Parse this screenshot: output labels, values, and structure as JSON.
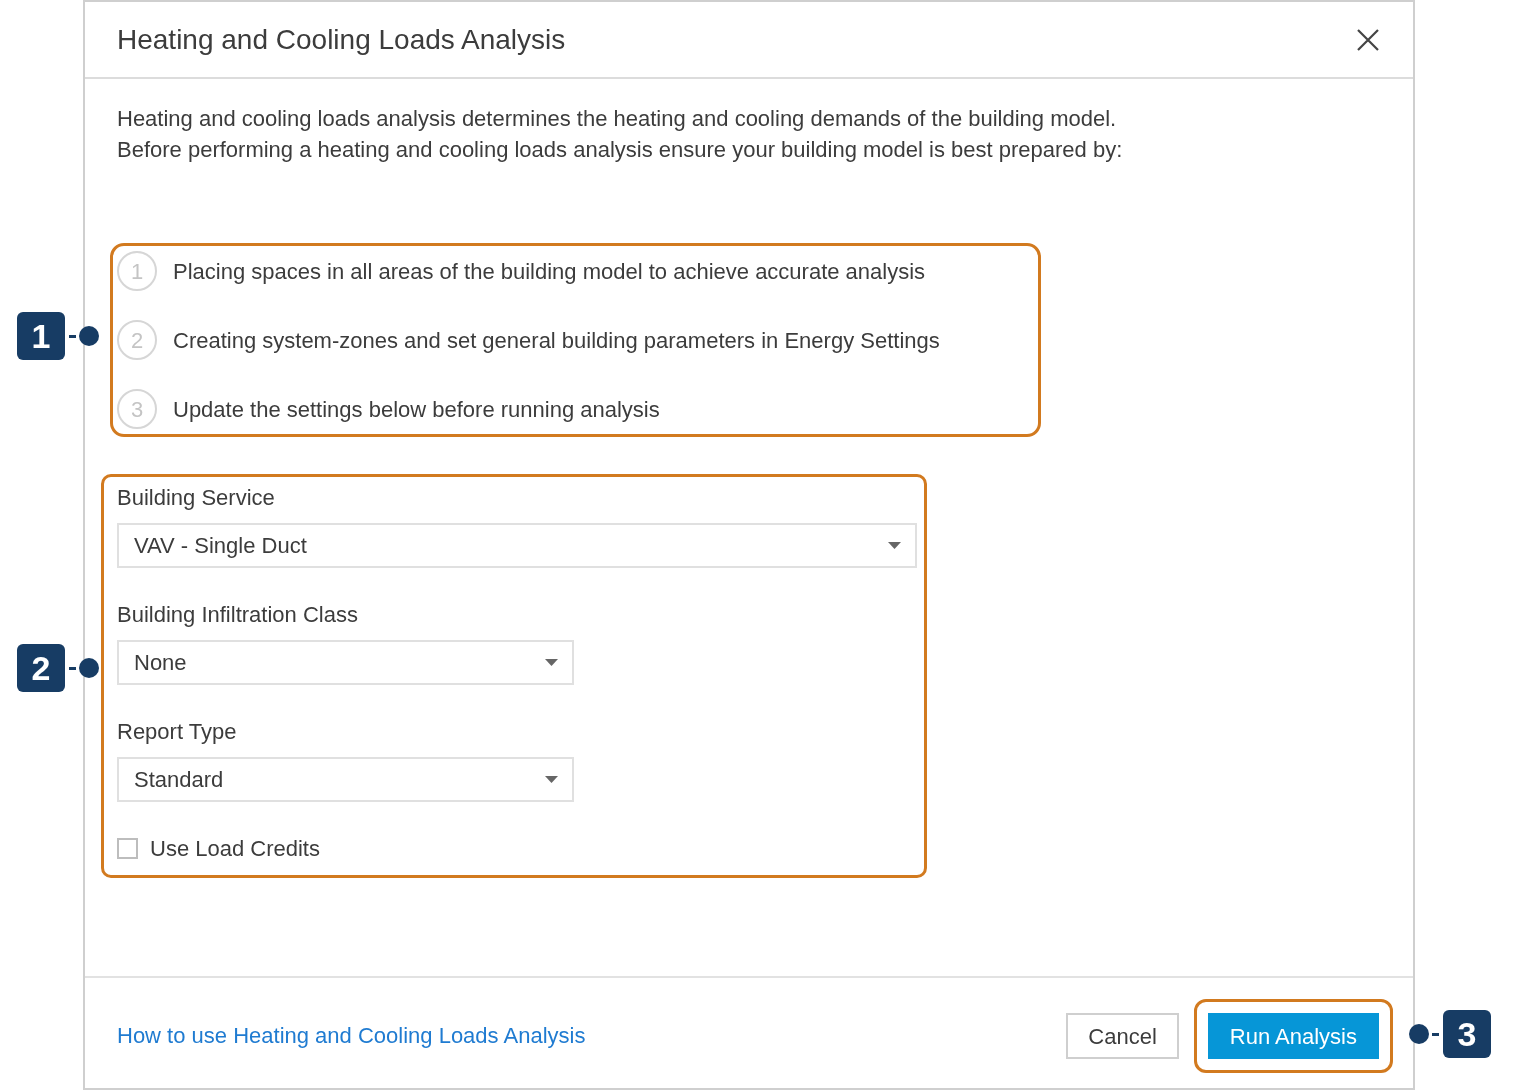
{
  "dialog": {
    "title": "Heating and Cooling Loads Analysis",
    "description": [
      "Heating and cooling loads analysis determines the heating and cooling demands of the building model.",
      "Before performing a heating and cooling loads analysis ensure your building model is best prepared by:"
    ],
    "steps": [
      {
        "number": "1",
        "text": "Placing spaces in all areas of the building model to achieve accurate analysis"
      },
      {
        "number": "2",
        "text": "Creating system-zones and set general building parameters in Energy Settings"
      },
      {
        "number": "3",
        "text": "Update the settings below before running analysis"
      }
    ],
    "fields": [
      {
        "label": "Building Service",
        "value": "VAV - Single Duct"
      },
      {
        "label": "Building Infiltration Class",
        "value": "None"
      },
      {
        "label": "Report Type",
        "value": "Standard"
      }
    ],
    "checkbox": {
      "label": "Use Load Credits",
      "checked": false
    },
    "help_link": "How to use Heating and Cooling Loads Analysis",
    "buttons": [
      {
        "label": "Cancel",
        "kind": "secondary"
      },
      {
        "label": "Run Analysis",
        "kind": "primary"
      }
    ]
  },
  "callouts": [
    {
      "number": "1"
    },
    {
      "number": "2"
    },
    {
      "number": "3"
    }
  ]
}
